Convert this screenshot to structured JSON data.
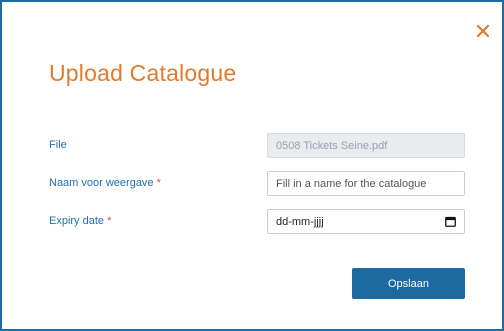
{
  "dialog": {
    "title": "Upload Catalogue",
    "close_icon": "close-icon",
    "accent_color": "#e07a2c",
    "primary_color": "#1d6aa0"
  },
  "form": {
    "file": {
      "label": "File",
      "value": "0508 Tickets Seine.pdf"
    },
    "display_name": {
      "label": "Naam voor weergave",
      "required_mark": "*",
      "placeholder": "Fill in a name for the catalogue"
    },
    "expiry_date": {
      "label": "Expiry date",
      "required_mark": "*",
      "value": "dd-mm-jjjj",
      "icon": "calendar-icon"
    }
  },
  "actions": {
    "save_label": "Opslaan"
  }
}
